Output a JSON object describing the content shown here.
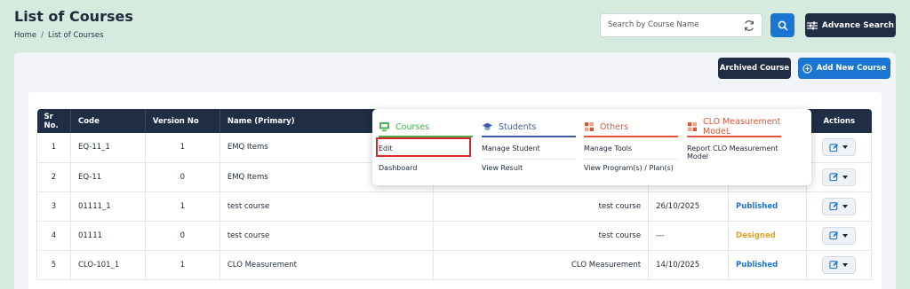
{
  "header": {
    "title": "List of Courses",
    "breadcrumb": [
      "Home",
      "List of Courses"
    ],
    "search_placeholder": "Search by Course Name",
    "advance_search_label": "Advance Search"
  },
  "toolbar": {
    "archived_label": "Archived Course",
    "add_label": "Add New Course"
  },
  "table": {
    "headers": [
      "Sr No.",
      "Code",
      "Version No",
      "Name (Primary)",
      "",
      "",
      "",
      "Actions"
    ],
    "rows": [
      {
        "sr": "1",
        "code": "EQ-11_1",
        "version": "1",
        "name": "EMQ Items",
        "name2": "",
        "date": "",
        "status": "",
        "status_class": ""
      },
      {
        "sr": "2",
        "code": "EQ-11",
        "version": "0",
        "name": "EMQ Items",
        "name2": "",
        "date": "",
        "status": "",
        "status_class": ""
      },
      {
        "sr": "3",
        "code": "01111_1",
        "version": "1",
        "name": "test course",
        "name2": "test course",
        "date": "26/10/2025",
        "status": "Published",
        "status_class": "published"
      },
      {
        "sr": "4",
        "code": "01111",
        "version": "0",
        "name": "test course",
        "name2": "test course",
        "date": "---",
        "status": "Designed",
        "status_class": "designed"
      },
      {
        "sr": "5",
        "code": "CLO-101_1",
        "version": "1",
        "name": "CLO Measurement",
        "name2": "CLO Measurement",
        "date": "14/10/2025",
        "status": "Published",
        "status_class": "published"
      }
    ]
  },
  "dropdown": {
    "columns": [
      {
        "title": "Courses",
        "icon": "monitor-icon",
        "color": "#4caf50",
        "items": [
          "Edit",
          "Dashboard"
        ]
      },
      {
        "title": "Students",
        "icon": "graduation-cap-icon",
        "color": "#3b5ba8",
        "items": [
          "Manage Student",
          "View Result"
        ]
      },
      {
        "title": "Others",
        "icon": "grid-icon",
        "color": "#e0553a",
        "items": [
          "Manage Tools",
          "View Program(s) / Plan(s)"
        ]
      },
      {
        "title": "CLO Measurement ModeL",
        "icon": "grid-icon",
        "color": "#e0553a",
        "items": [
          "Report CLO Measurement Model"
        ]
      }
    ]
  }
}
